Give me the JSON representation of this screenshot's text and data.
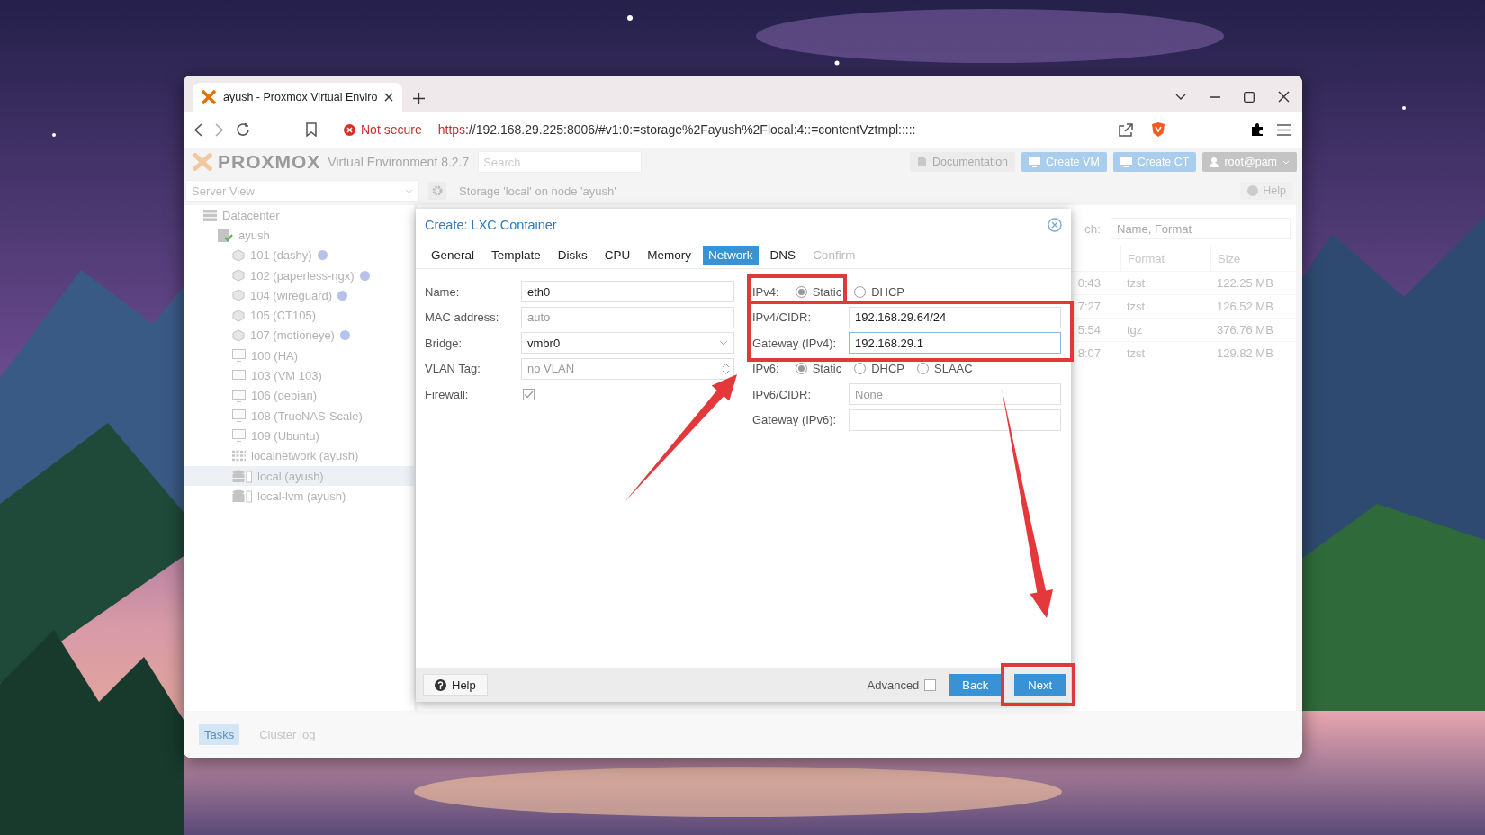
{
  "browser": {
    "tab_title": "ayush - Proxmox Virtual Enviro",
    "security_label": "Not secure",
    "url_scheme": "https",
    "url_rest": "://192.168.29.225:8006/#v1:0:=storage%2Fayush%2Flocal:4::=contentVztmpl:::::"
  },
  "app": {
    "logo": "PROXMOX",
    "version": "Virtual Environment 8.2.7",
    "search_placeholder": "Search",
    "header_buttons": [
      {
        "label": "Documentation",
        "kind": "plain"
      },
      {
        "label": "Create VM",
        "kind": "primary"
      },
      {
        "label": "Create CT",
        "kind": "primary"
      },
      {
        "label": "root@pam",
        "kind": "user"
      }
    ],
    "view_selector": "Server View",
    "content_title": "Storage 'local' on node 'ayush'",
    "help_label": "Help",
    "tree": [
      {
        "label": "Datacenter",
        "kind": "datacenter",
        "selected": false,
        "children": [
          {
            "label": "ayush",
            "kind": "node",
            "selected": false,
            "children": [
              {
                "label": "101 (dashy)",
                "kind": "container",
                "selected": false,
                "tagged": true
              },
              {
                "label": "102 (paperless-ngx)",
                "kind": "container",
                "selected": false,
                "tagged": true
              },
              {
                "label": "104 (wireguard)",
                "kind": "container",
                "selected": false,
                "tagged": true
              },
              {
                "label": "105 (CT105)",
                "kind": "container",
                "selected": false,
                "tagged": false
              },
              {
                "label": "107 (motioneye)",
                "kind": "container",
                "selected": false,
                "tagged": true
              },
              {
                "label": "100 (HA)",
                "kind": "vm",
                "selected": false,
                "tagged": false
              },
              {
                "label": "103 (VM 103)",
                "kind": "vm",
                "selected": false,
                "tagged": false
              },
              {
                "label": "106 (debian)",
                "kind": "vm",
                "selected": false,
                "tagged": false
              },
              {
                "label": "108 (TrueNAS-Scale)",
                "kind": "vm",
                "selected": false,
                "tagged": false
              },
              {
                "label": "109 (Ubuntu)",
                "kind": "vm",
                "selected": false,
                "tagged": false
              },
              {
                "label": "localnetwork (ayush)",
                "kind": "network",
                "selected": false,
                "tagged": false
              },
              {
                "label": "local (ayush)",
                "kind": "storage",
                "selected": true,
                "tagged": false
              },
              {
                "label": "local-lvm (ayush)",
                "kind": "storage",
                "selected": false,
                "tagged": false
              }
            ]
          }
        ]
      }
    ],
    "content": {
      "search_label": "ch:",
      "search_placeholder": "Name, Format",
      "columns": [
        {
          "label": "Format"
        },
        {
          "label": "Size"
        }
      ],
      "rows": [
        {
          "column_1": "0:43",
          "format": "tzst",
          "size": "122.25 MB"
        },
        {
          "column_1": "7:27",
          "format": "tzst",
          "size": "126.52 MB"
        },
        {
          "column_1": "5:54",
          "format": "tgz",
          "size": "376.76 MB"
        },
        {
          "column_1": "8:07",
          "format": "tzst",
          "size": "129.82 MB"
        }
      ]
    },
    "bottom_tabs": [
      {
        "label": "Tasks",
        "selected": true
      },
      {
        "label": "Cluster log",
        "selected": false
      }
    ]
  },
  "dialog": {
    "title": "Create: LXC Container",
    "tabs": [
      {
        "label": "General",
        "selected": false,
        "disabled": false
      },
      {
        "label": "Template",
        "selected": false,
        "disabled": false
      },
      {
        "label": "Disks",
        "selected": false,
        "disabled": false
      },
      {
        "label": "CPU",
        "selected": false,
        "disabled": false
      },
      {
        "label": "Memory",
        "selected": false,
        "disabled": false
      },
      {
        "label": "Network",
        "selected": true,
        "disabled": false
      },
      {
        "label": "DNS",
        "selected": false,
        "disabled": false
      },
      {
        "label": "Confirm",
        "selected": false,
        "disabled": true
      }
    ],
    "left_fields": [
      {
        "kind": "text",
        "label": "Name:",
        "value": "eth0"
      },
      {
        "kind": "text",
        "label": "MAC address:",
        "placeholder": "auto"
      },
      {
        "kind": "select",
        "label": "Bridge:",
        "value": "vmbr0"
      },
      {
        "kind": "spinner",
        "label": "VLAN Tag:",
        "placeholder": "no VLAN"
      },
      {
        "kind": "checkbox",
        "label": "Firewall:",
        "checked": true
      }
    ],
    "right_fields": [
      {
        "kind": "radio",
        "label": "IPv4:",
        "options": [
          {
            "label": "Static",
            "selected": true
          },
          {
            "label": "DHCP",
            "selected": false
          }
        ]
      },
      {
        "kind": "text",
        "label": "IPv4/CIDR:",
        "value": "192.168.29.64/24",
        "focused": false
      },
      {
        "kind": "text",
        "label": "Gateway (IPv4):",
        "value": "192.168.29.1",
        "focused": true
      },
      {
        "kind": "radio",
        "label": "IPv6:",
        "options": [
          {
            "label": "Static",
            "selected": true
          },
          {
            "label": "DHCP",
            "selected": false
          },
          {
            "label": "SLAAC",
            "selected": false
          }
        ]
      },
      {
        "kind": "text",
        "label": "IPv6/CIDR:",
        "placeholder": "None",
        "focused": false
      },
      {
        "kind": "text",
        "label": "Gateway (IPv6):",
        "focused": false
      }
    ],
    "help_label": "Help",
    "advanced": {
      "label": "Advanced",
      "checked": false
    },
    "buttons": [
      {
        "label": "Back"
      },
      {
        "label": "Next"
      }
    ]
  }
}
